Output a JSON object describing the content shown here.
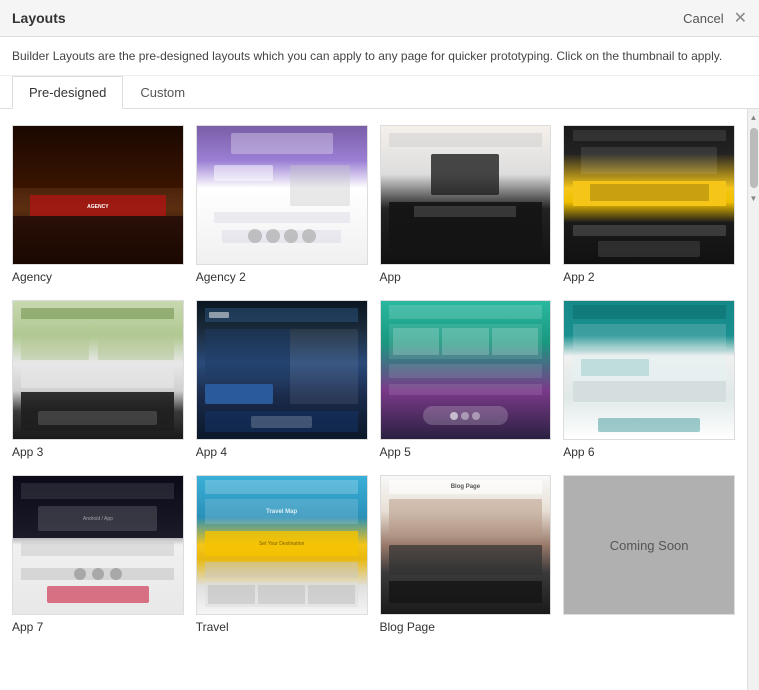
{
  "titleBar": {
    "title": "Layouts",
    "cancelLabel": "Cancel"
  },
  "description": "Builder Layouts are the pre-designed layouts which you can apply to any page for quicker prototyping. Click on the thumbnail to apply.",
  "tabs": [
    {
      "id": "predesigned",
      "label": "Pre-designed",
      "active": true
    },
    {
      "id": "custom",
      "label": "Custom",
      "active": false
    }
  ],
  "layouts": [
    {
      "id": "agency",
      "label": "Agency",
      "theme": "agency"
    },
    {
      "id": "agency2",
      "label": "Agency 2",
      "theme": "agency2"
    },
    {
      "id": "app",
      "label": "App",
      "theme": "app"
    },
    {
      "id": "app2",
      "label": "App 2",
      "theme": "app2"
    },
    {
      "id": "app3",
      "label": "App 3",
      "theme": "app3"
    },
    {
      "id": "app4",
      "label": "App 4",
      "theme": "app4"
    },
    {
      "id": "app5",
      "label": "App 5",
      "theme": "app5"
    },
    {
      "id": "app6",
      "label": "App 6",
      "theme": "app6"
    },
    {
      "id": "app7",
      "label": "App 7",
      "theme": "app7"
    },
    {
      "id": "travel",
      "label": "Travel",
      "theme": "travel"
    },
    {
      "id": "blog",
      "label": "Blog",
      "theme": "blog"
    },
    {
      "id": "soon",
      "label": "",
      "theme": "soon"
    }
  ],
  "icons": {
    "close": "✕",
    "scrollUp": "▲",
    "scrollDown": "▼"
  },
  "comingSoon": "Coming Soon"
}
